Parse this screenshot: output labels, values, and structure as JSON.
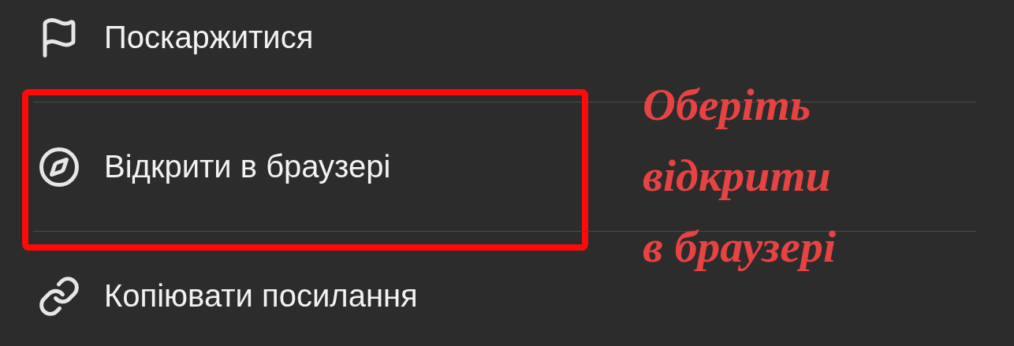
{
  "menu": {
    "items": [
      {
        "kind": "flag",
        "label": "Поскаржитися",
        "highlighted": false
      },
      {
        "kind": "compass",
        "label": "Відкрити в браузері",
        "highlighted": true
      },
      {
        "kind": "link",
        "label": "Копіювати посилання",
        "highlighted": false
      }
    ]
  },
  "annotation": {
    "lines": [
      "Оберіть",
      "відкрити",
      "в браузері"
    ]
  }
}
